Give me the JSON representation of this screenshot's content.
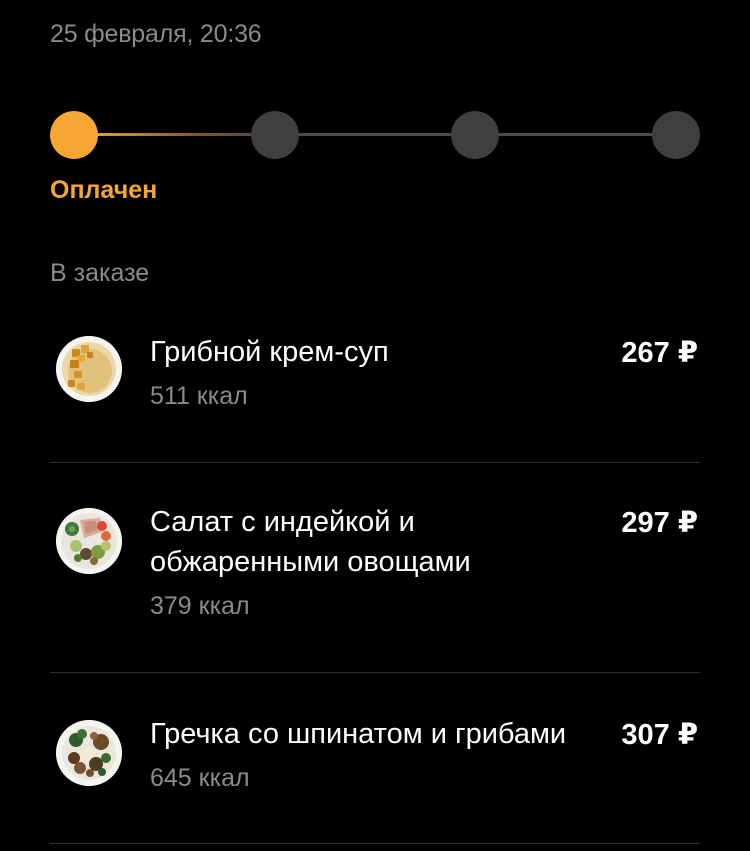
{
  "order": {
    "date": "25 февраля, 20:36",
    "status": "Оплачен",
    "progress": {
      "total_steps": 4,
      "completed_steps": 1,
      "active_color": "#f5a634",
      "inactive_color": "#3f3f3f"
    }
  },
  "section_title": "В заказе",
  "items": [
    {
      "name": "Грибной крем-суп",
      "kcal": "511 ккал",
      "price": "267 ₽",
      "image_icon": "mushroom-cream-soup-icon"
    },
    {
      "name_line1": "Салат с индейкой и",
      "name_line2": "обжаренными овощами",
      "kcal": "379 ккал",
      "price": "297 ₽",
      "image_icon": "turkey-salad-icon"
    },
    {
      "name": "Гречка со шпинатом и грибами",
      "kcal": "645 ккал",
      "price": "307 ₽",
      "image_icon": "buckwheat-spinach-icon"
    }
  ]
}
